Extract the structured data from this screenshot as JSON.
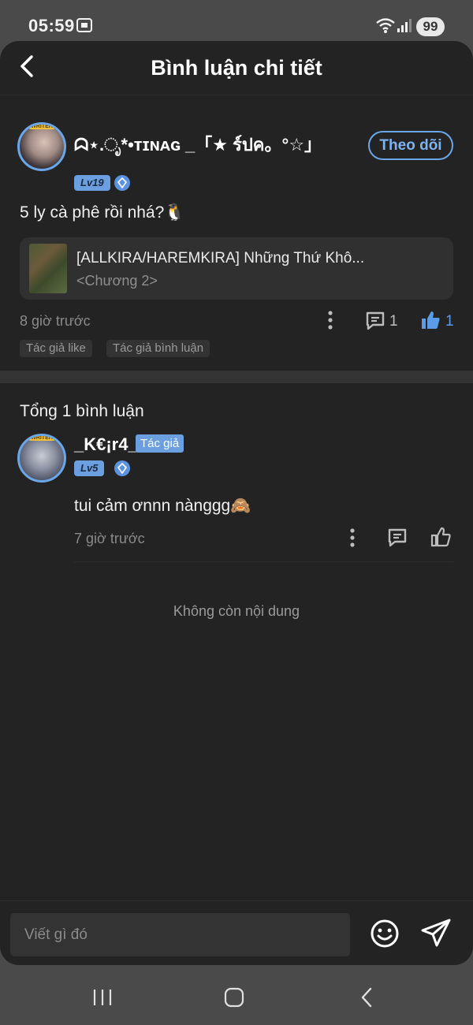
{
  "status_bar": {
    "time": "05:59",
    "battery": "99"
  },
  "header": {
    "title": "Bình luận chi tiết"
  },
  "main_comment": {
    "avatar_tag": "WRITER",
    "username": "ᗣ⋆.ೃ*•ᴛɪɴᴀɢ _「★ ร์ปค。°☆」",
    "level": "Lv19",
    "follow_label": "Theo dõi",
    "text": "5 ly cà phê rồi nhá?🐧",
    "chapter": {
      "title": "[ALLKIRA/HAREMKIRA] Những Thứ Khô...",
      "subtitle": "<Chương 2>"
    },
    "time": "8 giờ trước",
    "reply_count": "1",
    "like_count": "1",
    "chips": [
      "Tác giả like",
      "Tác giả bình luận"
    ]
  },
  "replies_section": {
    "total_label": "Tổng 1 bình luận",
    "replies": [
      {
        "avatar_tag": "WRITER",
        "username": "_K€¡r4_",
        "author_badge": "Tác giả",
        "level": "Lv5",
        "text": "tui cảm ơnnn nànggg🙈",
        "time": "7 giờ trước"
      }
    ],
    "end_label": "Không còn nội dung"
  },
  "input": {
    "placeholder": "Viết gì đó"
  },
  "colors": {
    "accent": "#6aa6e8",
    "background": "#232323",
    "like_active": "#5b9be8"
  }
}
